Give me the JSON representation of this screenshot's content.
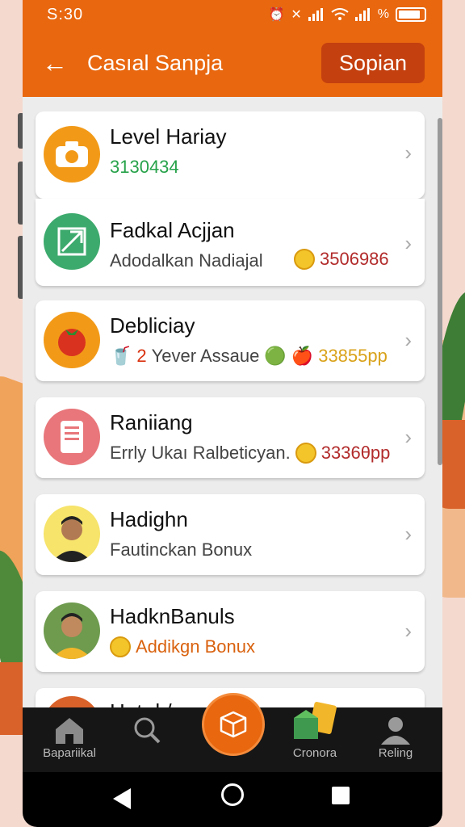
{
  "status_bar": {
    "time": "S:30",
    "icons": [
      "alarm-icon",
      "mute-icon",
      "signal-icon",
      "wifi-icon",
      "signal-icon",
      "battery-icon"
    ]
  },
  "header": {
    "title": "Casıal Sanpja",
    "action_label": "Sopian"
  },
  "list": [
    {
      "title": "Level Hariay",
      "subtitle": "3130434",
      "subtitle_color": "#27a24a",
      "icon": "camera-icon",
      "icon_bg": "#f29a18"
    },
    {
      "title": "Fadkal Acjjan",
      "subtitle": "Adodalkan Nadiajal",
      "value": "3506986",
      "value_color": "#b22b2b",
      "icon": "arrow-up-right-icon",
      "icon_bg": "#3daa6d",
      "badge": "coin-icon"
    },
    {
      "title": "Debliciay",
      "subtitle_prefix": "2",
      "subtitle": "Yever Assaue",
      "value": "33855pp",
      "value_color": "#d9a21a",
      "icon": "tomato-icon",
      "icon_bg": "#e8670f"
    },
    {
      "title": "Raniiang",
      "subtitle": "Errly Ukaı Ralbeticyan.",
      "value": "3336θpp",
      "value_color": "#b22b2b",
      "icon": "document-icon",
      "icon_bg": "#e8767a"
    },
    {
      "title": "Hadighn",
      "subtitle": "Fautinckan Bonux",
      "icon": "avatar-icon",
      "icon_bg": "#f6e46b"
    },
    {
      "title": "HadknBanuls",
      "subtitle": "Addikgn Bonux",
      "subtitle_color": "#d9620f",
      "icon": "avatar-icon",
      "icon_bg": "#6e9b4e",
      "badge": "coins-icon"
    },
    {
      "title": "Hutırlı/",
      "subtitle": "",
      "icon": "circle-icon",
      "icon_bg": "#d9622a"
    }
  ],
  "bottom_nav": [
    {
      "label": "Bapariikal",
      "icon": "home-icon"
    },
    {
      "label": "",
      "icon": "search-icon"
    },
    {
      "label": "",
      "icon": "box-icon"
    },
    {
      "label": "Cronora",
      "icon": "gift-box-icon"
    },
    {
      "label": "Reling",
      "icon": "person-icon"
    }
  ],
  "colors": {
    "accent": "#e8670f",
    "button_dark": "#c4400f"
  }
}
